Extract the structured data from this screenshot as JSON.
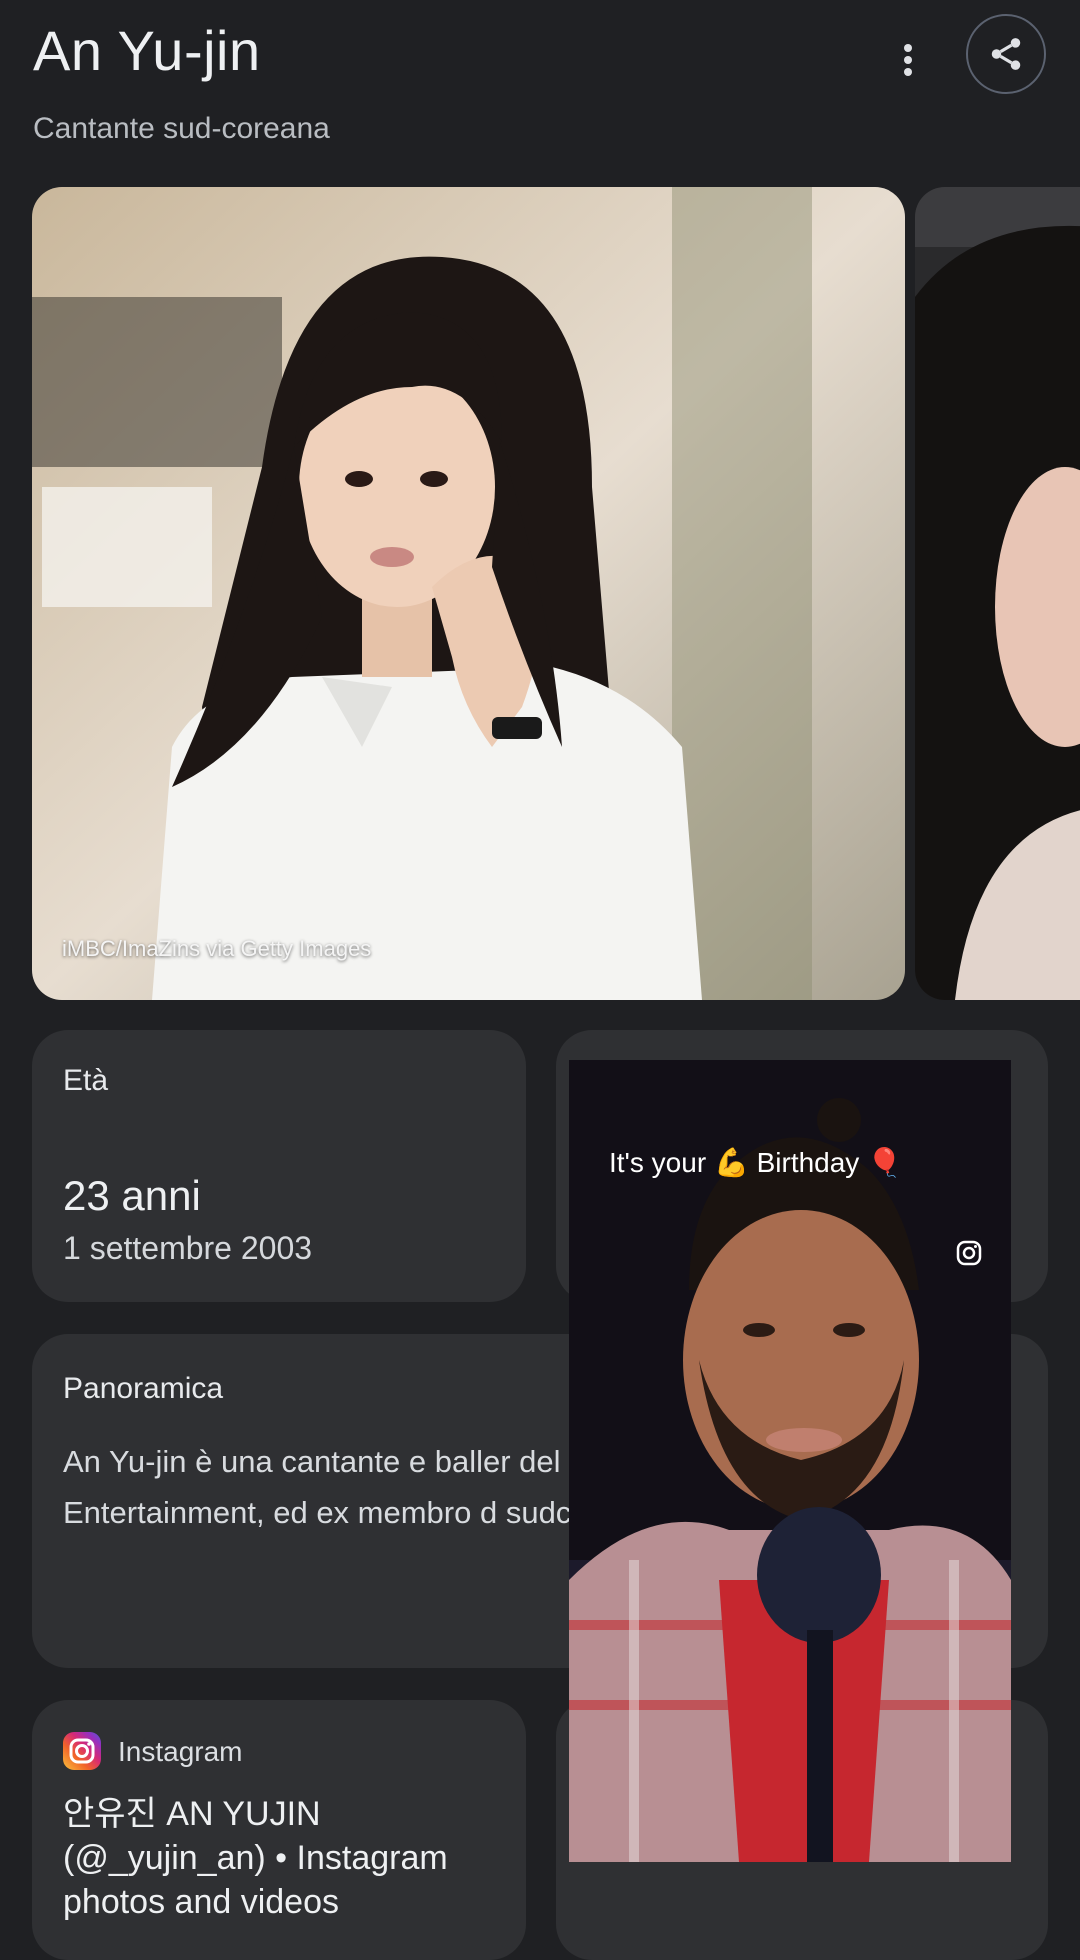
{
  "header": {
    "title": "An Yu-jin",
    "subtitle": "Cantante sud-coreana",
    "more_icon": "more-vert-icon",
    "share_icon": "share-icon"
  },
  "images": {
    "credit": "iMBC/ImaZins via Getty Images"
  },
  "age_card": {
    "label": "Età",
    "value": "23 anni",
    "birth_date": "1 settembre 2003"
  },
  "overview": {
    "label": "Panoramica",
    "text": "An Yu-jin è una cantante e baller del gruppo femminile Ive, sotto l Entertainment, ed ex membro d sudcoreano-giapponese Iz*One"
  },
  "instagram": {
    "icon": "instagram-icon",
    "source": "Instagram",
    "title": "안유진 AN YUJIN (@_yujin_an) • Instagram photos and videos"
  },
  "video_overlay": {
    "caption_before": "It's your",
    "caption_after": "Birthday"
  },
  "colors": {
    "background": "#1f2023",
    "card": "#2f3033",
    "text": "#e8eaed"
  }
}
